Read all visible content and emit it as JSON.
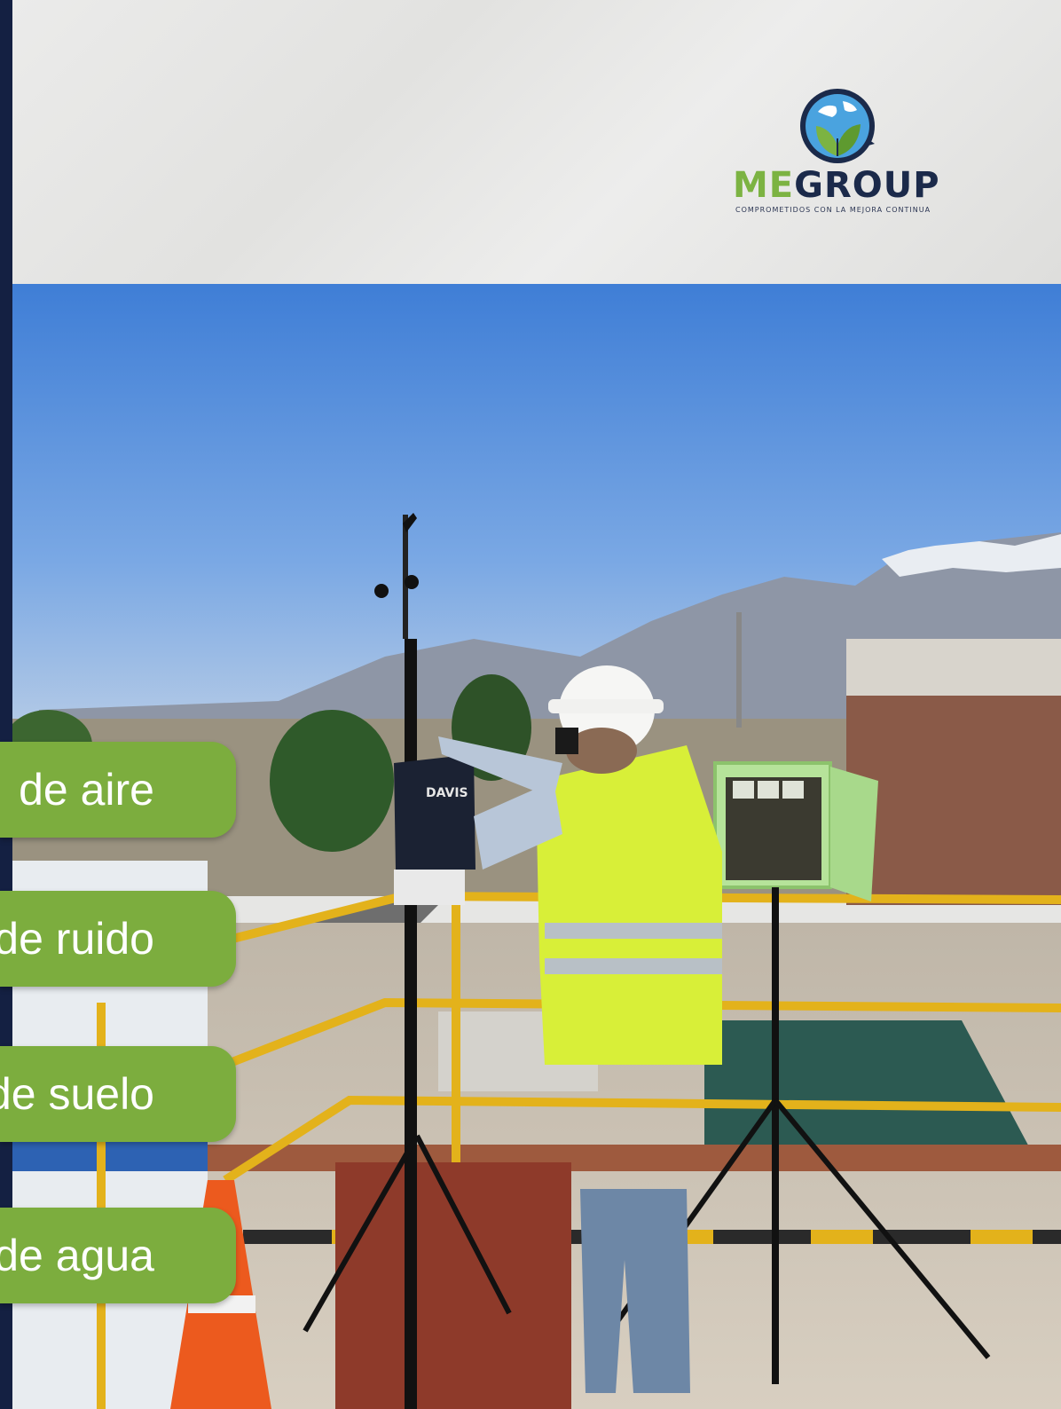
{
  "brand": {
    "name_part1": "ME",
    "name_part2": "GROUP",
    "tagline": "COMPROMETIDOS CON LA MEJORA CONTINUA",
    "colors": {
      "green": "#7cb342",
      "navy": "#1b2a4a"
    }
  },
  "services": [
    {
      "label": "de aire"
    },
    {
      "label": "de ruido"
    },
    {
      "label": "de suelo"
    },
    {
      "label": "de agua"
    }
  ],
  "photo": {
    "device_label": "DAVIS"
  },
  "colors": {
    "pill": "#7cad3e",
    "sidebar": "#142042"
  }
}
